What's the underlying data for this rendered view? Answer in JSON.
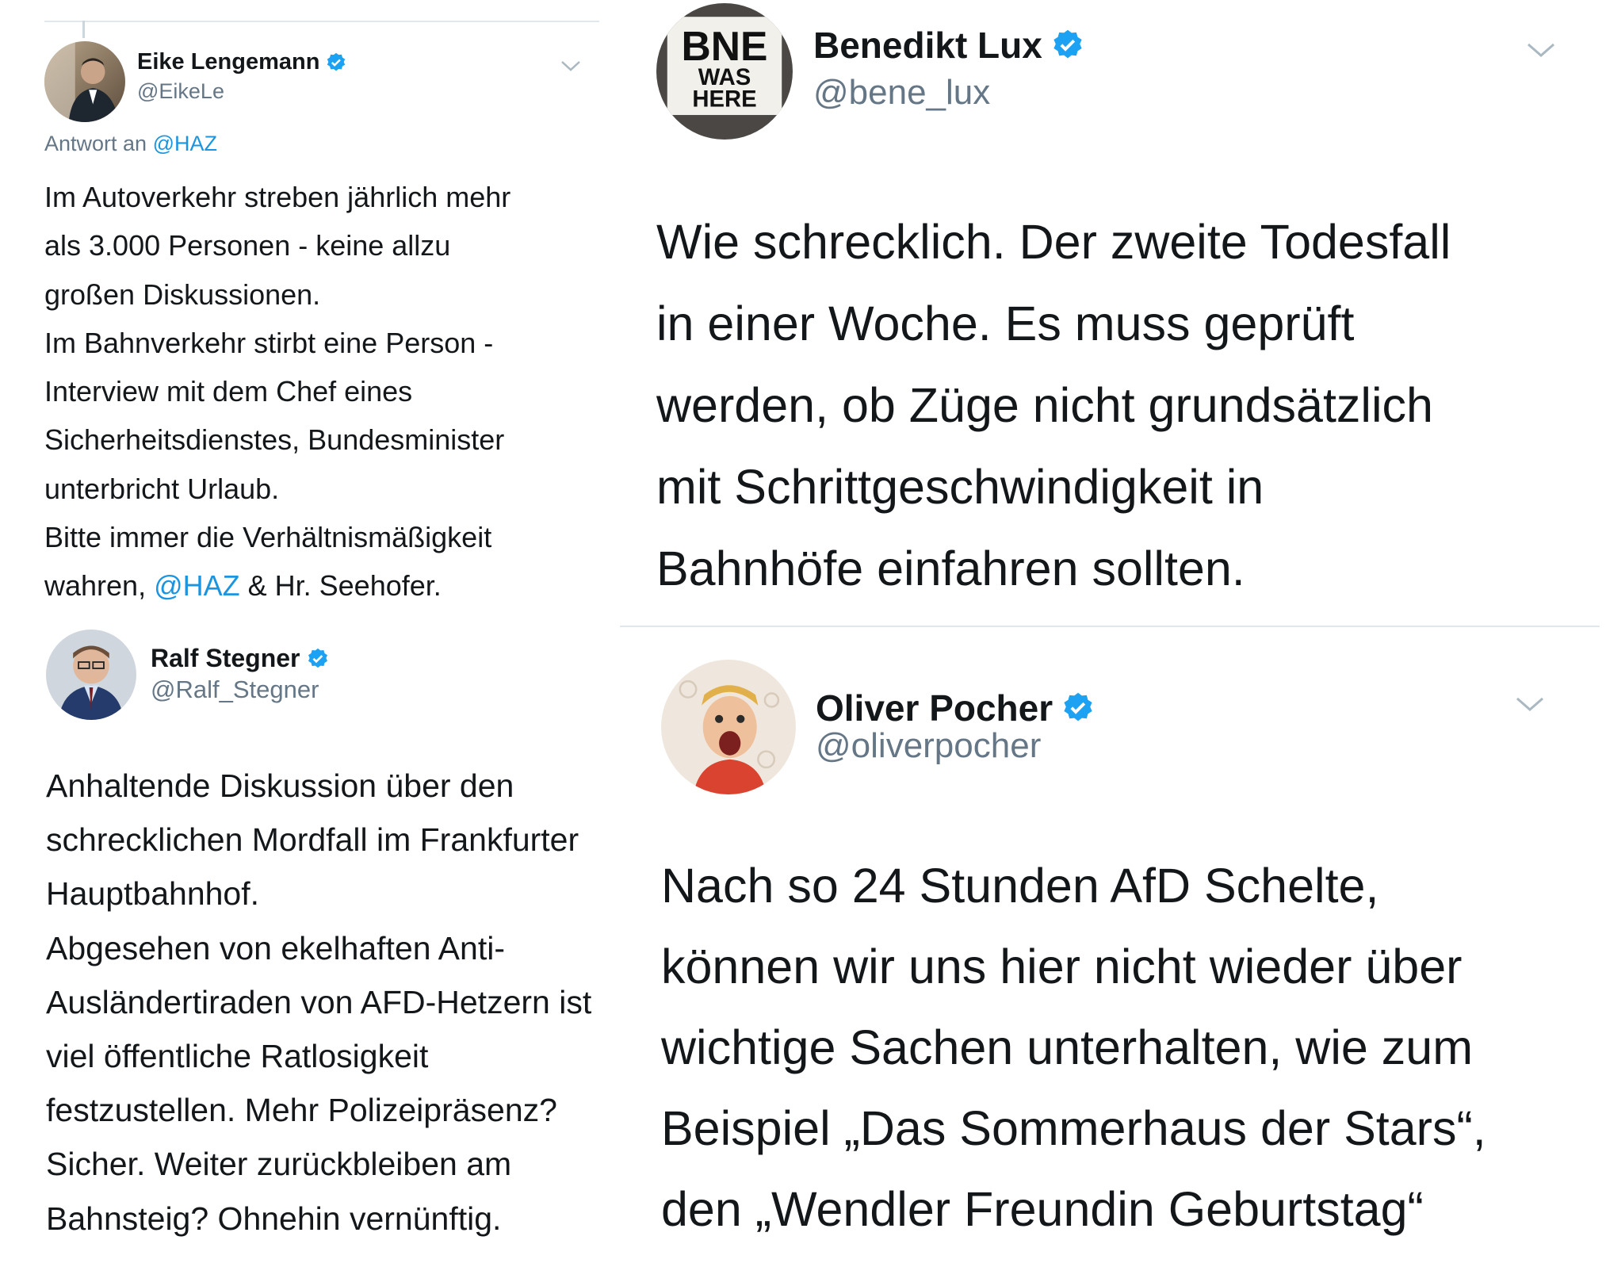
{
  "tweets": {
    "eike": {
      "name": "Eike Lengemann",
      "handle": "@EikeLe",
      "reply_prefix": "Antwort an",
      "reply_to": "@HAZ",
      "lines": [
        "Im Autoverkehr streben jährlich mehr",
        "als 3.000 Personen - keine allzu",
        "großen Diskussionen.",
        "Im Bahnverkehr stirbt eine Person -",
        "Interview mit dem Chef eines",
        "Sicherheitsdienstes, Bundesminister",
        "unterbricht Urlaub.",
        "Bitte immer die Verhältnismäßigkeit"
      ],
      "last_line_prefix": "wahren, ",
      "last_line_mention": "@HAZ",
      "last_line_suffix": " & Hr. Seehofer."
    },
    "ralf": {
      "name": "Ralf Stegner",
      "handle": "@Ralf_Stegner",
      "lines": [
        "Anhaltende Diskussion über den",
        "schrecklichen Mordfall im Frankfurter",
        "Hauptbahnhof.",
        "Abgesehen von ekelhaften Anti-",
        "Ausländertiraden von AFD-Hetzern ist",
        "viel öffentliche Ratlosigkeit",
        "festzustellen. Mehr Polizeipräsenz?",
        "Sicher. Weiter zurückbleiben am",
        "Bahnsteig? Ohnehin vernünftig."
      ]
    },
    "bene": {
      "name": "Benedikt Lux",
      "handle": "@bene_lux",
      "avatar_text": [
        "BNE",
        "WAS",
        "HERE"
      ],
      "lines": [
        "Wie schrecklich. Der zweite Todesfall",
        "in einer Woche. Es muss geprüft",
        "werden, ob Züge nicht grundsätzlich",
        "mit Schrittgeschwindigkeit in",
        "Bahnhöfe einfahren sollten."
      ]
    },
    "oliver": {
      "name": "Oliver Pocher",
      "handle": "@oliverpocher",
      "lines": [
        "Nach so 24 Stunden AfD Schelte,",
        "können wir uns hier nicht wieder über",
        "wichtige Sachen unterhalten, wie zum",
        "Beispiel „Das Sommerhaus der Stars“,",
        "den „Wendler Freundin Geburtstag“"
      ]
    }
  },
  "icons": {
    "verified": "verified-badge-icon",
    "menu": "chevron-down-icon"
  },
  "colors": {
    "link": "#1b95e0",
    "verified": "#1da1f2",
    "secondary_text": "#657786",
    "primary_text": "#14171a",
    "divider": "#e1e8ed"
  }
}
